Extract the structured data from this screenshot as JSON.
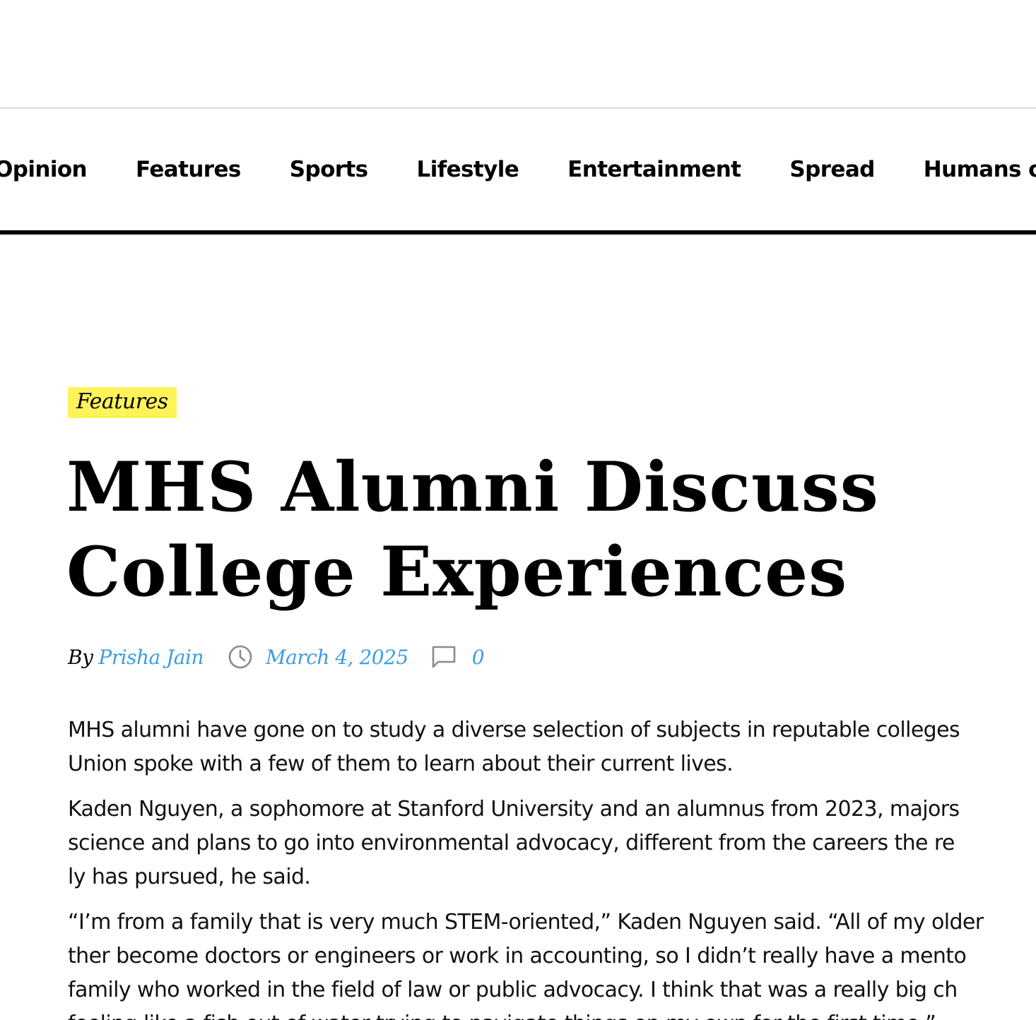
{
  "nav": {
    "items": [
      {
        "label": "Opinion"
      },
      {
        "label": "Features"
      },
      {
        "label": "Sports"
      },
      {
        "label": "Lifestyle"
      },
      {
        "label": "Entertainment"
      },
      {
        "label": "Spread"
      },
      {
        "label": "Humans of M"
      }
    ]
  },
  "article": {
    "category": "Features",
    "headline_line1": "MHS Alumni Discuss",
    "headline_line2": "College Experiences",
    "byline": {
      "by_label": "By",
      "author": "Prisha Jain",
      "date": "March 4, 2025",
      "comment_count": "0"
    },
    "paragraphs": [
      {
        "lines": [
          "MHS alumni have gone on to study a diverse selection of subjects in reputable colleges",
          "Union spoke with a few of them to learn about their current lives."
        ]
      },
      {
        "lines": [
          "Kaden Nguyen, a sophomore at Stanford University and an alumnus from 2023, majors",
          "science and plans to go into environmental advocacy, different from the careers the re",
          "ly has pursued, he said."
        ]
      },
      {
        "lines": [
          "“I’m from a family that is very much STEM-oriented,” Kaden Nguyen said. “All of my older",
          "ther become doctors or engineers or work in accounting, so I didn’t really have a mento",
          "family who worked in the field of law or public advocacy. I think that was a really big ch",
          "feeling like a fish out of water trying to navigate things on my own for the first time.”"
        ]
      }
    ]
  },
  "colors": {
    "accent_link": "#3a9ee4",
    "category_highlight": "#fff35a",
    "nav_rule": "#000000"
  },
  "icons": {
    "date": "clock-icon",
    "comments": "comment-bubble-icon"
  }
}
